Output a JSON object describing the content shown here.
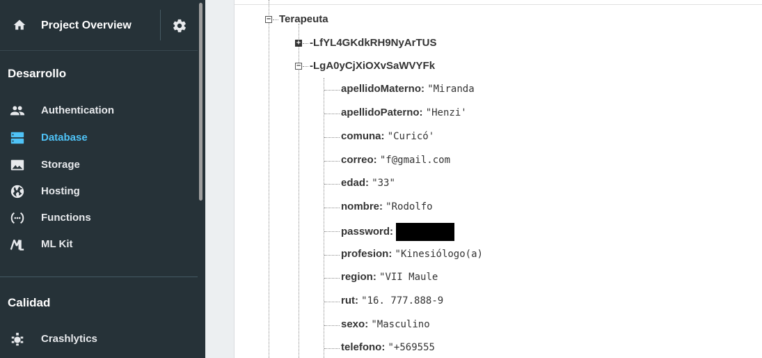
{
  "sidebar": {
    "project_overview": "Project Overview",
    "section_develop": "Desarrollo",
    "develop_items": [
      {
        "label": "Authentication",
        "icon": "people-icon"
      },
      {
        "label": "Database",
        "icon": "database-icon",
        "active": true
      },
      {
        "label": "Storage",
        "icon": "image-icon"
      },
      {
        "label": "Hosting",
        "icon": "globe-icon"
      },
      {
        "label": "Functions",
        "icon": "functions-icon"
      },
      {
        "label": "ML Kit",
        "icon": "ml-kit-icon"
      }
    ],
    "section_quality": "Calidad",
    "quality_items": [
      {
        "label": "Crashlytics",
        "icon": "crashlytics-icon"
      }
    ]
  },
  "tree": {
    "root": "Terapeuta",
    "children": [
      {
        "key": "-LfYL4GKdkRH9NyArTUS",
        "expanded": false
      },
      {
        "key": "-LgA0yCjXiOXvSaWVYFk",
        "expanded": true
      }
    ],
    "fields": [
      {
        "key": "apellidoMaterno:",
        "value": "\"Miranda"
      },
      {
        "key": "apellidoPaterno:",
        "value": "\"Henzi'"
      },
      {
        "key": "comuna:",
        "value": "\"Curicó'"
      },
      {
        "key": "correo:",
        "value": "\"f@gmail.com"
      },
      {
        "key": "edad:",
        "value": "\"33\""
      },
      {
        "key": "nombre:",
        "value": "\"Rodolfo"
      },
      {
        "key": "password:",
        "value": ""
      },
      {
        "key": "profesion:",
        "value": "\"Kinesiólogo(a)"
      },
      {
        "key": "region:",
        "value": "\"VII Maule"
      },
      {
        "key": "rut:",
        "value": "\"16. 777.888-9"
      },
      {
        "key": "sexo:",
        "value": "\"Masculino"
      },
      {
        "key": "telefono:",
        "value": "\"+569555"
      }
    ]
  },
  "colors": {
    "sidebar_bg": "#263238",
    "active": "#4fc3f7",
    "text_light": "#e8eaed"
  }
}
